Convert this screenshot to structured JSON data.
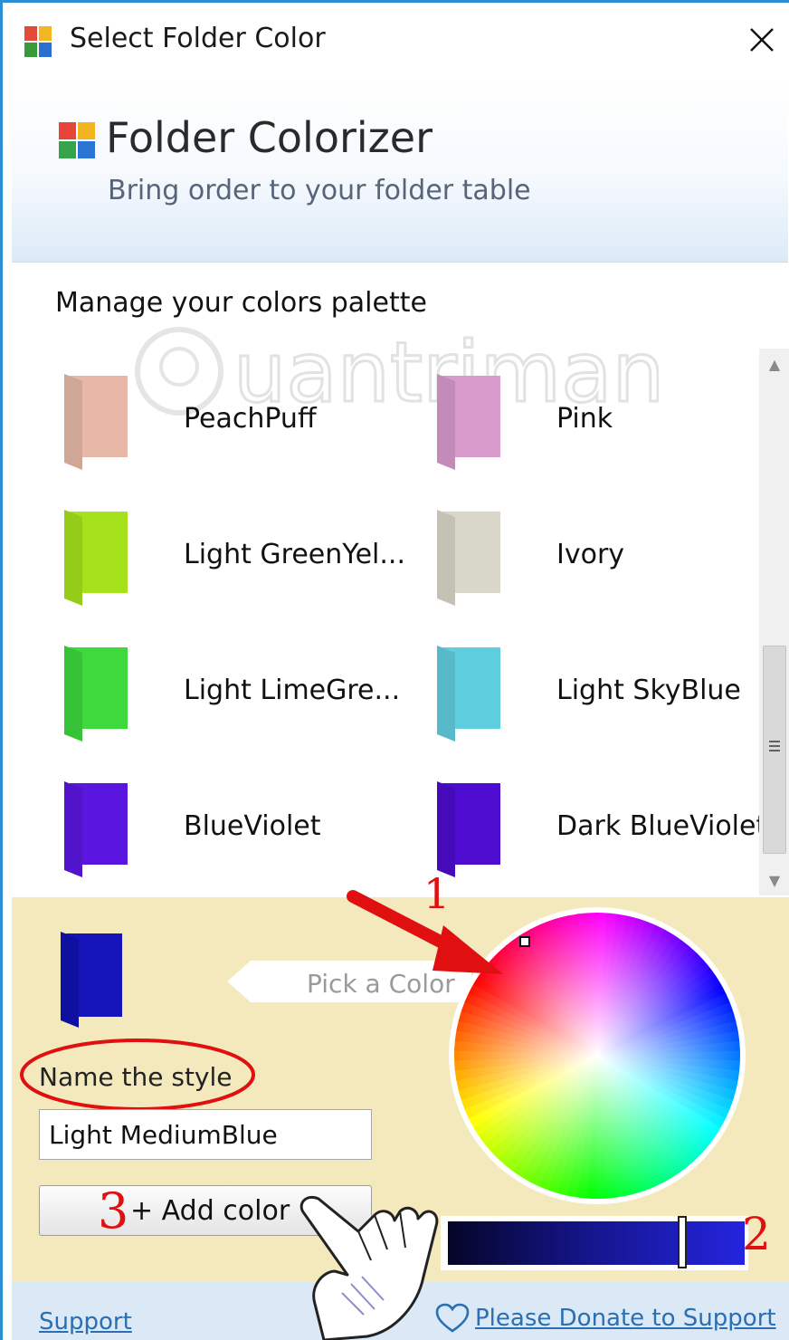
{
  "window": {
    "title": "Select Folder Color",
    "close_icon": "close-icon"
  },
  "banner": {
    "app_name": "Folder Colorizer",
    "tagline": "Bring order to your folder table"
  },
  "palette": {
    "title": "Manage your colors palette",
    "watermark": "uantrimang",
    "items": [
      {
        "label": "PeachPuff",
        "color": "#e7b8a8"
      },
      {
        "label": "Pink",
        "color": "#d99bcc"
      },
      {
        "label": "Light GreenYel...",
        "color": "#a6e21c"
      },
      {
        "label": "Ivory",
        "color": "#d9d7c8"
      },
      {
        "label": "Light LimeGre...",
        "color": "#3dd93d"
      },
      {
        "label": "Light SkyBlue",
        "color": "#5fcfe0"
      },
      {
        "label": "BlueViolet",
        "color": "#5a16e0"
      },
      {
        "label": "Dark BlueViolet",
        "color": "#4d0cd0"
      }
    ]
  },
  "editor": {
    "preview_color": "#1414b8",
    "pick_hint": "Pick a Color",
    "name_label": "Name the style",
    "name_value": "Light MediumBlue",
    "add_button": "+ Add color",
    "brightness_value": 0.8
  },
  "footer": {
    "support": "Support",
    "donate": "Please Donate to Support"
  },
  "annotations": {
    "step1": "1",
    "step2": "2",
    "step3": "3"
  }
}
